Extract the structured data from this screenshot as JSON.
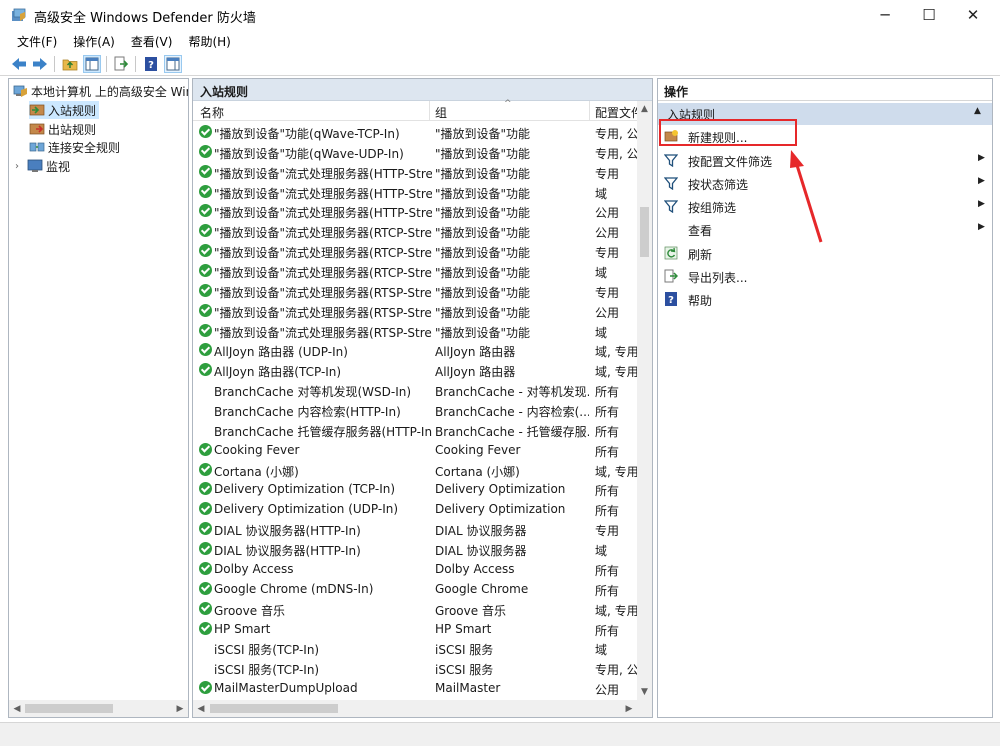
{
  "window": {
    "title": "高级安全 Windows Defender 防火墙",
    "min_glyph": "─",
    "max_glyph": "☐",
    "close_glyph": "✕"
  },
  "menu": [
    "文件(F)",
    "操作(A)",
    "查看(V)",
    "帮助(H)"
  ],
  "tree": {
    "root": "本地计算机 上的高级安全 Windows",
    "items": [
      "入站规则",
      "出站规则",
      "连接安全规则",
      "监视"
    ],
    "selected_index": 0
  },
  "middle": {
    "header": "入站规则",
    "columns": {
      "name": "名称",
      "group": "组",
      "profile": "配置文件"
    },
    "rows": [
      {
        "enabled": true,
        "name": "\"播放到设备\"功能(qWave-TCP-In)",
        "group": "\"播放到设备\"功能",
        "profile": "专用, 公"
      },
      {
        "enabled": true,
        "name": "\"播放到设备\"功能(qWave-UDP-In)",
        "group": "\"播放到设备\"功能",
        "profile": "专用, 公"
      },
      {
        "enabled": true,
        "name": "\"播放到设备\"流式处理服务器(HTTP-Stre...",
        "group": "\"播放到设备\"功能",
        "profile": "专用"
      },
      {
        "enabled": true,
        "name": "\"播放到设备\"流式处理服务器(HTTP-Stre...",
        "group": "\"播放到设备\"功能",
        "profile": "域"
      },
      {
        "enabled": true,
        "name": "\"播放到设备\"流式处理服务器(HTTP-Stre...",
        "group": "\"播放到设备\"功能",
        "profile": "公用"
      },
      {
        "enabled": true,
        "name": "\"播放到设备\"流式处理服务器(RTCP-Stre...",
        "group": "\"播放到设备\"功能",
        "profile": "公用"
      },
      {
        "enabled": true,
        "name": "\"播放到设备\"流式处理服务器(RTCP-Stre...",
        "group": "\"播放到设备\"功能",
        "profile": "专用"
      },
      {
        "enabled": true,
        "name": "\"播放到设备\"流式处理服务器(RTCP-Stre...",
        "group": "\"播放到设备\"功能",
        "profile": "域"
      },
      {
        "enabled": true,
        "name": "\"播放到设备\"流式处理服务器(RTSP-Stre...",
        "group": "\"播放到设备\"功能",
        "profile": "专用"
      },
      {
        "enabled": true,
        "name": "\"播放到设备\"流式处理服务器(RTSP-Stre...",
        "group": "\"播放到设备\"功能",
        "profile": "公用"
      },
      {
        "enabled": true,
        "name": "\"播放到设备\"流式处理服务器(RTSP-Stre...",
        "group": "\"播放到设备\"功能",
        "profile": "域"
      },
      {
        "enabled": true,
        "name": "AllJoyn 路由器 (UDP-In)",
        "group": "AllJoyn 路由器",
        "profile": "域, 专用"
      },
      {
        "enabled": true,
        "name": "AllJoyn 路由器(TCP-In)",
        "group": "AllJoyn 路由器",
        "profile": "域, 专用"
      },
      {
        "enabled": false,
        "name": "BranchCache 对等机发现(WSD-In)",
        "group": "BranchCache - 对等机发现...",
        "profile": "所有"
      },
      {
        "enabled": false,
        "name": "BranchCache 内容检索(HTTP-In)",
        "group": "BranchCache - 内容检索(...",
        "profile": "所有"
      },
      {
        "enabled": false,
        "name": "BranchCache 托管缓存服务器(HTTP-In)",
        "group": "BranchCache - 托管缓存服...",
        "profile": "所有"
      },
      {
        "enabled": true,
        "name": "Cooking Fever",
        "group": "Cooking Fever",
        "profile": "所有"
      },
      {
        "enabled": true,
        "name": "Cortana (小娜)",
        "group": "Cortana (小娜)",
        "profile": "域, 专用"
      },
      {
        "enabled": true,
        "name": "Delivery Optimization (TCP-In)",
        "group": "Delivery Optimization",
        "profile": "所有"
      },
      {
        "enabled": true,
        "name": "Delivery Optimization (UDP-In)",
        "group": "Delivery Optimization",
        "profile": "所有"
      },
      {
        "enabled": true,
        "name": "DIAL 协议服务器(HTTP-In)",
        "group": "DIAL 协议服务器",
        "profile": "专用"
      },
      {
        "enabled": true,
        "name": "DIAL 协议服务器(HTTP-In)",
        "group": "DIAL 协议服务器",
        "profile": "域"
      },
      {
        "enabled": true,
        "name": "Dolby Access",
        "group": "Dolby Access",
        "profile": "所有"
      },
      {
        "enabled": true,
        "name": "Google Chrome (mDNS-In)",
        "group": "Google Chrome",
        "profile": "所有"
      },
      {
        "enabled": true,
        "name": "Groove 音乐",
        "group": "Groove 音乐",
        "profile": "域, 专用"
      },
      {
        "enabled": true,
        "name": "HP Smart",
        "group": "HP Smart",
        "profile": "所有"
      },
      {
        "enabled": false,
        "name": "iSCSI 服务(TCP-In)",
        "group": "iSCSI 服务",
        "profile": "域"
      },
      {
        "enabled": false,
        "name": "iSCSI 服务(TCP-In)",
        "group": "iSCSI 服务",
        "profile": "专用, 公"
      },
      {
        "enabled": true,
        "name": "MailMasterDumpUpload",
        "group": "MailMaster",
        "profile": "公用"
      }
    ]
  },
  "actions": {
    "header": "操作",
    "section": "入站规则",
    "items": [
      {
        "label": "新建规则...",
        "icon": "new-rule-icon",
        "submenu": false
      },
      {
        "label": "按配置文件筛选",
        "icon": "filter-icon",
        "submenu": true
      },
      {
        "label": "按状态筛选",
        "icon": "filter-icon",
        "submenu": true
      },
      {
        "label": "按组筛选",
        "icon": "filter-icon",
        "submenu": true
      },
      {
        "label": "查看",
        "icon": "",
        "submenu": true
      },
      {
        "label": "刷新",
        "icon": "refresh-icon",
        "submenu": false
      },
      {
        "label": "导出列表...",
        "icon": "export-icon",
        "submenu": false
      },
      {
        "label": "帮助",
        "icon": "help-icon",
        "submenu": false
      }
    ]
  },
  "colors": {
    "enabled_check": "#2e9e3e",
    "selection": "#cce8ff",
    "annotation": "#e6282a"
  }
}
